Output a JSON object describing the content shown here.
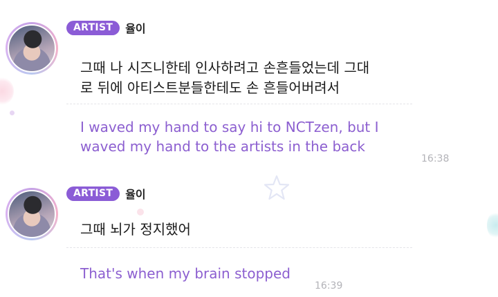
{
  "messages": [
    {
      "badge": "ARTIST",
      "name": "율이",
      "korean_lines": [
        "그때 나 시즈니한테 인사하려고 손흔들었는데 그대",
        "로 뒤에 아티스트분들한테도 손 흔들어버려서"
      ],
      "english_lines": [
        "I waved my hand to say hi to NCTzen, but I",
        "waved my hand to the artists in the back"
      ],
      "time": "16:38"
    },
    {
      "badge": "ARTIST",
      "name": "율이",
      "korean_lines": [
        "그때 뇌가 정지했어"
      ],
      "english_lines": [
        "That's when my brain stopped"
      ],
      "time": "16:39"
    }
  ],
  "colors": {
    "badge": "#8b5cd6",
    "english_text": "#8c5fd0",
    "timestamp": "#b3b3b8"
  },
  "icons": [
    "avatar",
    "star-icon"
  ]
}
